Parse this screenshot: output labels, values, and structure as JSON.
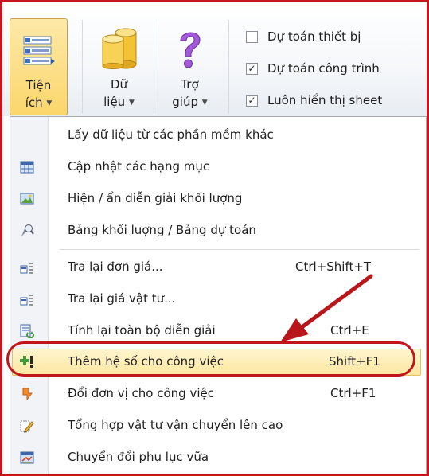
{
  "ribbon": {
    "buttons": [
      {
        "line1": "Tiện",
        "line2": "ích"
      },
      {
        "line1": "Dữ",
        "line2": "liệu"
      },
      {
        "line1": "Trợ",
        "line2": "giúp"
      }
    ],
    "checkboxes": [
      {
        "label": "Dự toán thiết bị",
        "checked": false
      },
      {
        "label": "Dự toán công trình",
        "checked": true
      },
      {
        "label": "Luôn hiển thị sheet",
        "checked": true
      }
    ]
  },
  "menu": {
    "items": [
      {
        "label": "Lấy dữ liệu từ các phần mềm khác",
        "shortcut": "",
        "icon": "none"
      },
      {
        "label": "Cập nhật các hạng mục",
        "shortcut": "",
        "icon": "grid-update-icon"
      },
      {
        "label": "Hiện / ẩn diễn giải khối lượng",
        "shortcut": "",
        "icon": "picture-toggle-icon"
      },
      {
        "label": "Bảng khối lượng / Bảng dự toán",
        "shortcut": "",
        "icon": "magnifier-table-icon"
      },
      {
        "label": "Tra lại đơn giá...",
        "shortcut": "Ctrl+Shift+T",
        "icon": "price-lookup-icon"
      },
      {
        "label": "Tra lại giá vật tư...",
        "shortcut": "",
        "icon": "material-price-icon"
      },
      {
        "label": "Tính lại toàn bộ diễn giải",
        "shortcut": "Ctrl+E",
        "icon": "recalculate-icon"
      },
      {
        "label": "Thêm hệ số cho công việc",
        "shortcut": "Shift+F1",
        "icon": "add-coefficient-icon"
      },
      {
        "label": "Đổi đơn vị cho công việc",
        "shortcut": "Ctrl+F1",
        "icon": "change-unit-icon"
      },
      {
        "label": "Tổng hợp vật tư vận chuyển lên cao",
        "shortcut": "",
        "icon": "pencil-summary-icon"
      },
      {
        "label": "Chuyển đổi phụ lục vữa",
        "shortcut": "",
        "icon": "convert-appendix-icon"
      }
    ],
    "highlighted_index": 7
  },
  "colors": {
    "annotation_red": "#c0151b",
    "highlight": "#fde7a0",
    "ribbon_active": "#fbd66b"
  }
}
